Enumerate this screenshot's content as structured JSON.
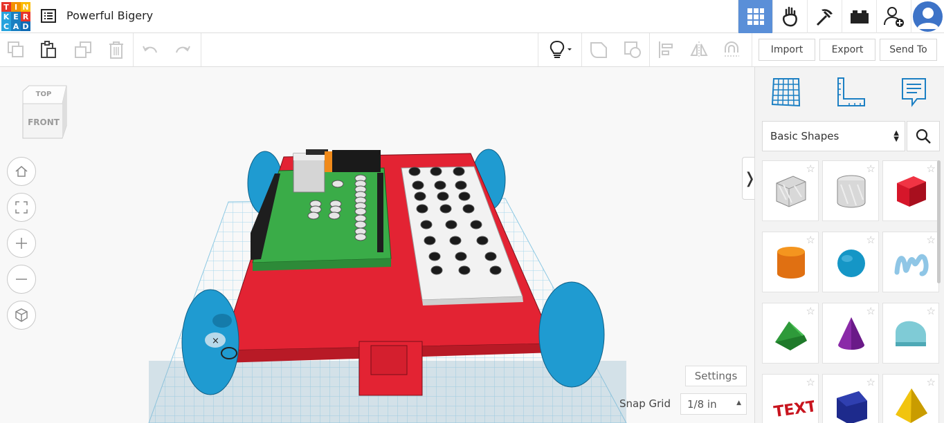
{
  "app": {
    "logo_letters": [
      "T",
      "I",
      "N",
      "K",
      "E",
      "R",
      "C",
      "A",
      "D"
    ],
    "logo_colors": [
      "#e6332a",
      "#f39200",
      "#fbba00",
      "#27a3dd",
      "#1a7fc1",
      "#e6332a",
      "#27a3dd",
      "#1a7fc1",
      "#0f6ab4"
    ],
    "design_title": "Powerful Bigery"
  },
  "topbar": {
    "buttons": [
      {
        "name": "3d-design-view",
        "icon": "grid-icon",
        "active": true
      },
      {
        "name": "simulation-view",
        "icon": "hand-icon",
        "active": false
      },
      {
        "name": "minecraft-view",
        "icon": "pickaxe-icon",
        "active": false
      },
      {
        "name": "bricks-view",
        "icon": "brick-icon",
        "active": false
      },
      {
        "name": "invite-user",
        "icon": "add-user-icon",
        "active": false
      }
    ],
    "accent": "#5a8fd8"
  },
  "toolbar": {
    "copy_icon": "copy-icon",
    "paste_icon": "paste-icon",
    "duplicate_icon": "duplicate-icon",
    "delete_icon": "trash-icon",
    "undo_icon": "undo-icon",
    "redo_icon": "redo-icon",
    "notes_icon": "lightbulb-icon",
    "import_label": "Import",
    "export_label": "Export",
    "send_to_label": "Send To"
  },
  "workplane": {
    "viewcube": {
      "top": "TOP",
      "front": "FRONT"
    },
    "settings_label": "Settings",
    "snap_grid_label": "Snap Grid",
    "snap_grid_value": "1/8 in",
    "colors": {
      "base": "#e32333",
      "board": "#3aac48",
      "wheel": "#1f9bd1",
      "plate": "#f2f2f2",
      "grid": "#9fd3ea"
    }
  },
  "panel": {
    "tabs": [
      "workplane-icon",
      "ruler-icon",
      "notes-icon"
    ],
    "shape_category": "Basic Shapes",
    "shapes": [
      {
        "name": "box-hole",
        "icon": "box-icon"
      },
      {
        "name": "cylinder-hole",
        "icon": "cylinder-icon"
      },
      {
        "name": "box",
        "icon": "box-icon"
      },
      {
        "name": "cylinder",
        "icon": "cylinder-icon"
      },
      {
        "name": "sphere",
        "icon": "sphere-icon"
      },
      {
        "name": "scribble",
        "icon": "scribble-icon"
      },
      {
        "name": "roof",
        "icon": "roof-icon"
      },
      {
        "name": "cone",
        "icon": "cone-icon"
      },
      {
        "name": "round-roof",
        "icon": "round-roof-icon"
      },
      {
        "name": "text",
        "icon": "text-icon"
      },
      {
        "name": "polygon",
        "icon": "polygon-icon"
      },
      {
        "name": "pyramid",
        "icon": "pyramid-icon"
      }
    ]
  }
}
